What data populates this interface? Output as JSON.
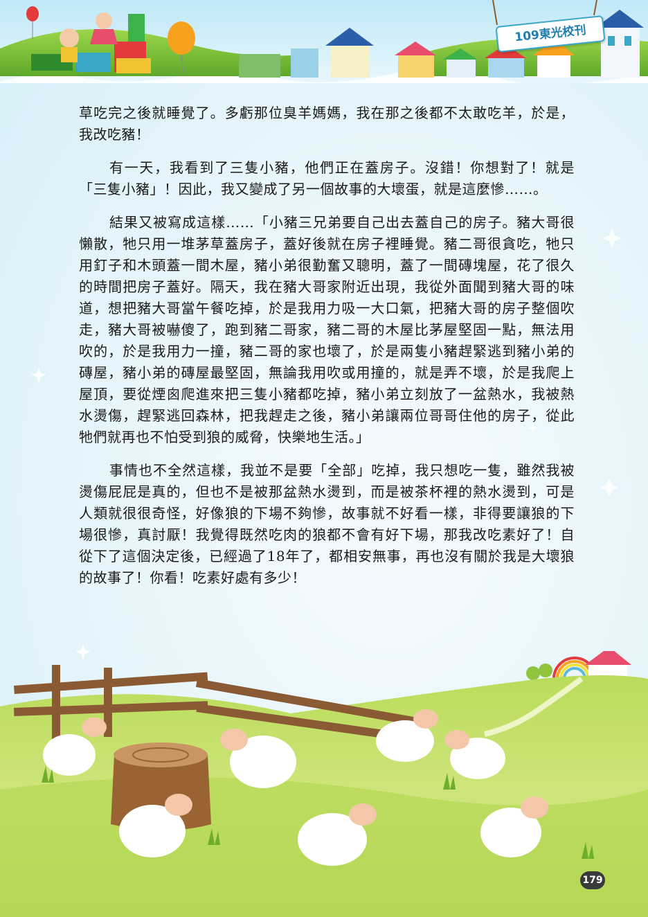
{
  "header": {
    "journal_label": "109東光校刊"
  },
  "article": {
    "paragraphs": [
      "草吃完之後就睡覺了。多虧那位臭羊媽媽，我在那之後都不太敢吃羊，於是，我改吃豬！",
      "有一天，我看到了三隻小豬，他們正在蓋房子。沒錯！你想對了！就是「三隻小豬」！因此，我又變成了另一個故事的大壞蛋，就是這麼慘……。",
      "結果又被寫成這樣……「小豬三兄弟要自己出去蓋自己的房子。豬大哥很懶散，牠只用一堆茅草蓋房子，蓋好後就在房子裡睡覺。豬二哥很貪吃，牠只用釘子和木頭蓋一間木屋，豬小弟很勤奮又聰明，蓋了一間磚塊屋，花了很久的時間把房子蓋好。隔天，我在豬大哥家附近出現，我從外面聞到豬大哥的味道，想把豬大哥當午餐吃掉，於是我用力吸一大口氣，把豬大哥的房子整個吹走，豬大哥被嚇傻了，跑到豬二哥家，豬二哥的木屋比茅屋堅固一點，無法用吹的，於是我用力一撞，豬二哥的家也壞了，於是兩隻小豬趕緊逃到豬小弟的磚屋，豬小弟的磚屋最堅固，無論我用吹或用撞的，就是弄不壞，於是我爬上屋頂，要從煙囪爬進來把三隻小豬都吃掉，豬小弟立刻放了一盆熱水，我被熱水燙傷，趕緊逃回森林，把我趕走之後，豬小弟讓兩位哥哥住他的房子，從此牠們就再也不怕受到狼的威脅，快樂地生活。」",
      "事情也不全然這樣，我並不是要「全部」吃掉，我只想吃一隻，雖然我被燙傷屁屁是真的，但也不是被那盆熱水燙到，而是被茶杯裡的熱水燙到，可是人類就很很奇怪，好像狼的下場不夠慘，故事就不好看一樣，非得要讓狼的下場很慘，真討厭！我覺得既然吃肉的狼都不會有好下場，那我改吃素好了！自從下了這個決定後，已經過了18年了，都相安無事，再也沒有關於我是大壞狼的故事了！你看！吃素好處有多少！"
    ]
  },
  "footer": {
    "page_number": "179"
  }
}
